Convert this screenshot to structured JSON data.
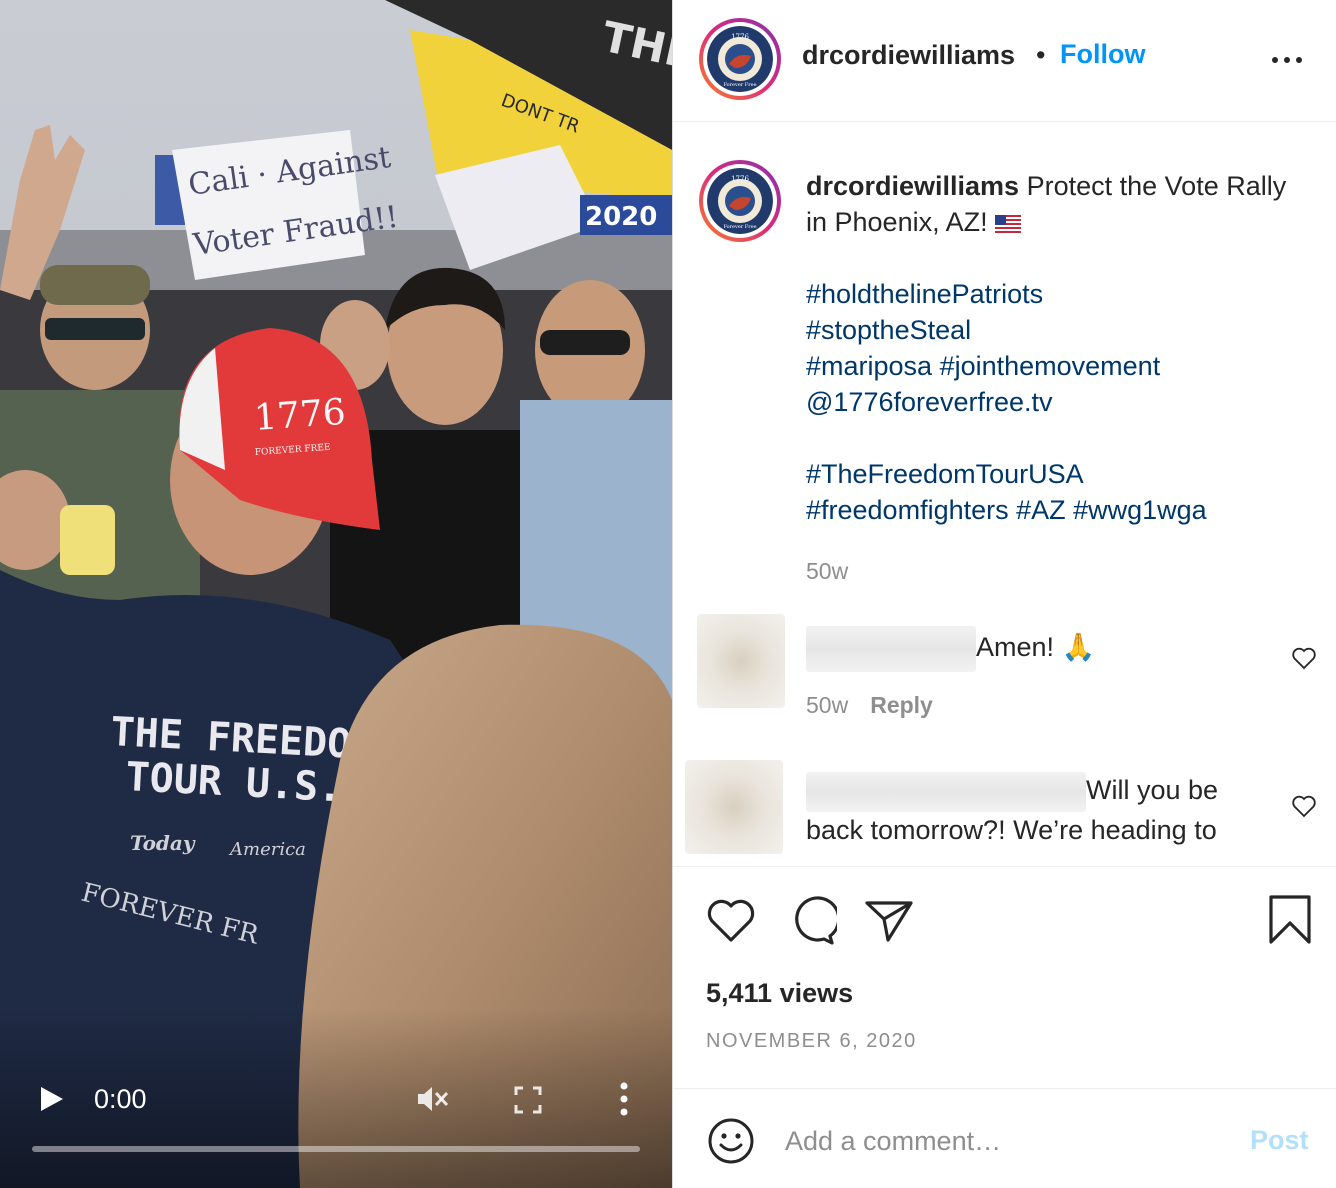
{
  "video": {
    "time": "0:00",
    "progress": 0,
    "shirt_text_line1": "THE FREEDOM",
    "shirt_text_line2": "TOUR U.S.A",
    "shirt_text_line3": "Today",
    "shirt_text_line4": "America",
    "shirt_text_line5": "FOREVER FR",
    "cap_text": "1776",
    "cap_subtext": "FOREVER FREE",
    "sign_text_line1": "Cali · Against",
    "sign_text_line2": "Voter Fraud!!",
    "sign2_text": "2020",
    "flag_text": "THE SE",
    "yellow_flag_text": "DONT TR",
    "icons": {
      "play": "play-icon",
      "mute": "muted-speaker-icon",
      "fullscreen": "fullscreen-icon",
      "more": "vertical-dots-icon"
    }
  },
  "header": {
    "username": "drcordiewilliams",
    "dot": "•",
    "follow_label": "Follow",
    "avatar_text_top": "1776",
    "avatar_text_bottom": "Forever Free"
  },
  "caption": {
    "username": "drcordiewilliams",
    "text": "Protect the Vote Rally in Phoenix, AZ!",
    "hashtags_1": [
      "#holdthelinePatriots",
      "#stoptheSteal",
      "#mariposa #jointhemovement",
      "@1776foreverfree.tv"
    ],
    "hashtags_2": [
      "#TheFreedomTourUSA",
      "#freedomfighters #AZ #wwg1wga"
    ],
    "age": "50w"
  },
  "comments": [
    {
      "text": "Amen! 🙏",
      "age": "50w",
      "reply_label": "Reply"
    },
    {
      "text_line1": "Will you be",
      "text_line2": "back tomorrow?! We’re heading to"
    }
  ],
  "actions": {
    "icons": [
      "heart-icon",
      "comment-icon",
      "share-icon",
      "bookmark-icon"
    ],
    "views": "5,411 views",
    "date": "NOVEMBER 6, 2020"
  },
  "comment_box": {
    "placeholder": "Add a comment…",
    "post_label": "Post"
  },
  "colors": {
    "accent": "#0095f6",
    "hashtag": "#00376b",
    "muted": "#8e8e8e",
    "post_disabled": "#b2dffc"
  }
}
